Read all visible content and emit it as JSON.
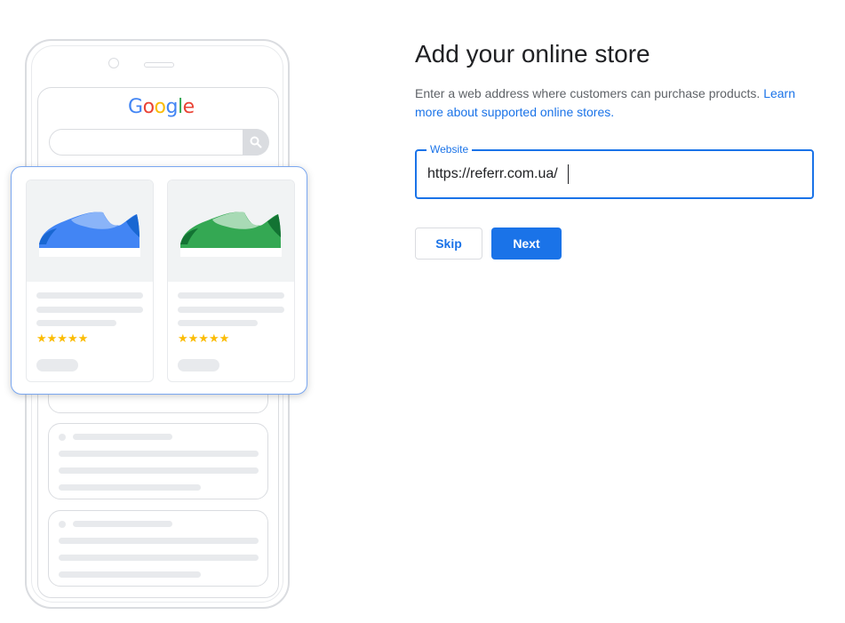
{
  "illustration": {
    "logo": {
      "letters": [
        "G",
        "o",
        "o",
        "g",
        "l",
        "e"
      ]
    },
    "product_cards": [
      {
        "name": "blue-shoe",
        "color": "#1a73e8",
        "rating": 5
      },
      {
        "name": "green-shoe",
        "color": "#1e8e3e",
        "rating": 5
      }
    ]
  },
  "main": {
    "title": "Add your online store",
    "description": "Enter a web address where customers can purchase products.",
    "learn_more_link": "Learn more about supported online stores.",
    "website_field": {
      "label": "Website",
      "value": "https://referr.com.ua/"
    },
    "buttons": {
      "skip": "Skip",
      "next": "Next"
    }
  },
  "colors": {
    "accent": "#1a73e8",
    "star": "#fbbc04",
    "border": "#dadce0"
  }
}
